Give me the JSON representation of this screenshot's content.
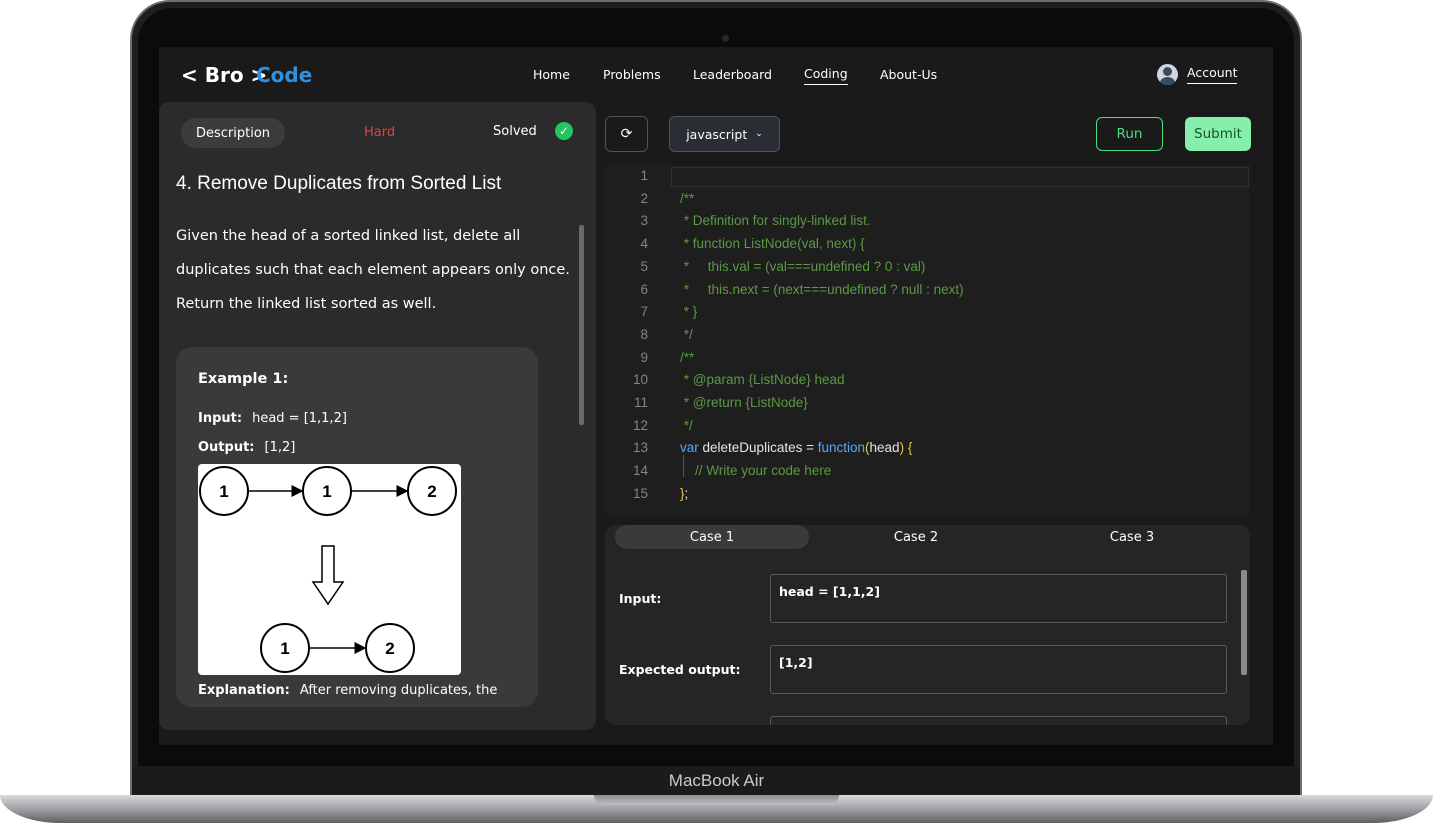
{
  "device": {
    "label": "MacBook Air"
  },
  "nav": {
    "logo_open": "< ",
    "logo_code": "Code",
    "logo_bro": "Bro",
    "logo_close": " >",
    "links": [
      "Home",
      "Problems",
      "Leaderboard",
      "Coding",
      "About-Us"
    ],
    "active": "Coding",
    "account": "Account"
  },
  "problem": {
    "tab": "Description",
    "difficulty": "Hard",
    "status": "Solved",
    "title": "4. Remove Duplicates from Sorted List",
    "description": "Given the head of a sorted linked list, delete all duplicates such that each element appears only once. Return the linked list sorted as well.",
    "example": {
      "title": "Example 1:",
      "input_label": "Input:",
      "input_value": "head = [1,1,2]",
      "output_label": "Output:",
      "output_value": "[1,2]",
      "diagram_top": [
        "1",
        "1",
        "2"
      ],
      "diagram_bottom": [
        "1",
        "2"
      ],
      "explanation_label": "Explanation:",
      "explanation_value": "After removing duplicates, the"
    }
  },
  "editor": {
    "language": "javascript",
    "run": "Run",
    "submit": "Submit",
    "line_numbers": [
      "1",
      "2",
      "3",
      "4",
      "5",
      "6",
      "7",
      "8",
      "9",
      "10",
      "11",
      "12",
      "13",
      "14",
      "15"
    ],
    "lines": [
      "",
      "/**",
      " * Definition for singly-linked list.",
      " * function ListNode(val, next) {",
      " *     this.val = (val===undefined ? 0 : val)",
      " *     this.next = (next===undefined ? null : next)",
      " * }",
      " */",
      "/**",
      " * @param {ListNode} head",
      " * @return {ListNode}",
      " */",
      "",
      "    // Write your code here",
      ""
    ],
    "line13": {
      "kw": "var",
      "name": " deleteDuplicates = ",
      "fn": "function",
      "open": "(",
      "param": "head",
      "close": ")",
      "brace": " {"
    },
    "line15": {
      "brace": "}",
      "semi": ";"
    }
  },
  "tests": {
    "tabs": [
      "Case 1",
      "Case 2",
      "Case 3"
    ],
    "active": "Case 1",
    "input_label": "Input:",
    "input_value": "head = [1,1,2]",
    "expected_label": "Expected output:",
    "expected_value": "[1,2]"
  },
  "colors": {
    "accent_blue": "#2f8fe0",
    "hard": "#e0413a",
    "solved_check": "#22c55e",
    "run": "#4ade80",
    "submit_bg": "#86efac",
    "comment": "#5b9a43",
    "keyword": "#5ba7f0"
  },
  "icons": {
    "refresh": "refresh-icon",
    "check": "check-circle-icon",
    "chevron": "chevron-down-icon",
    "avatar": "user-avatar-icon"
  }
}
